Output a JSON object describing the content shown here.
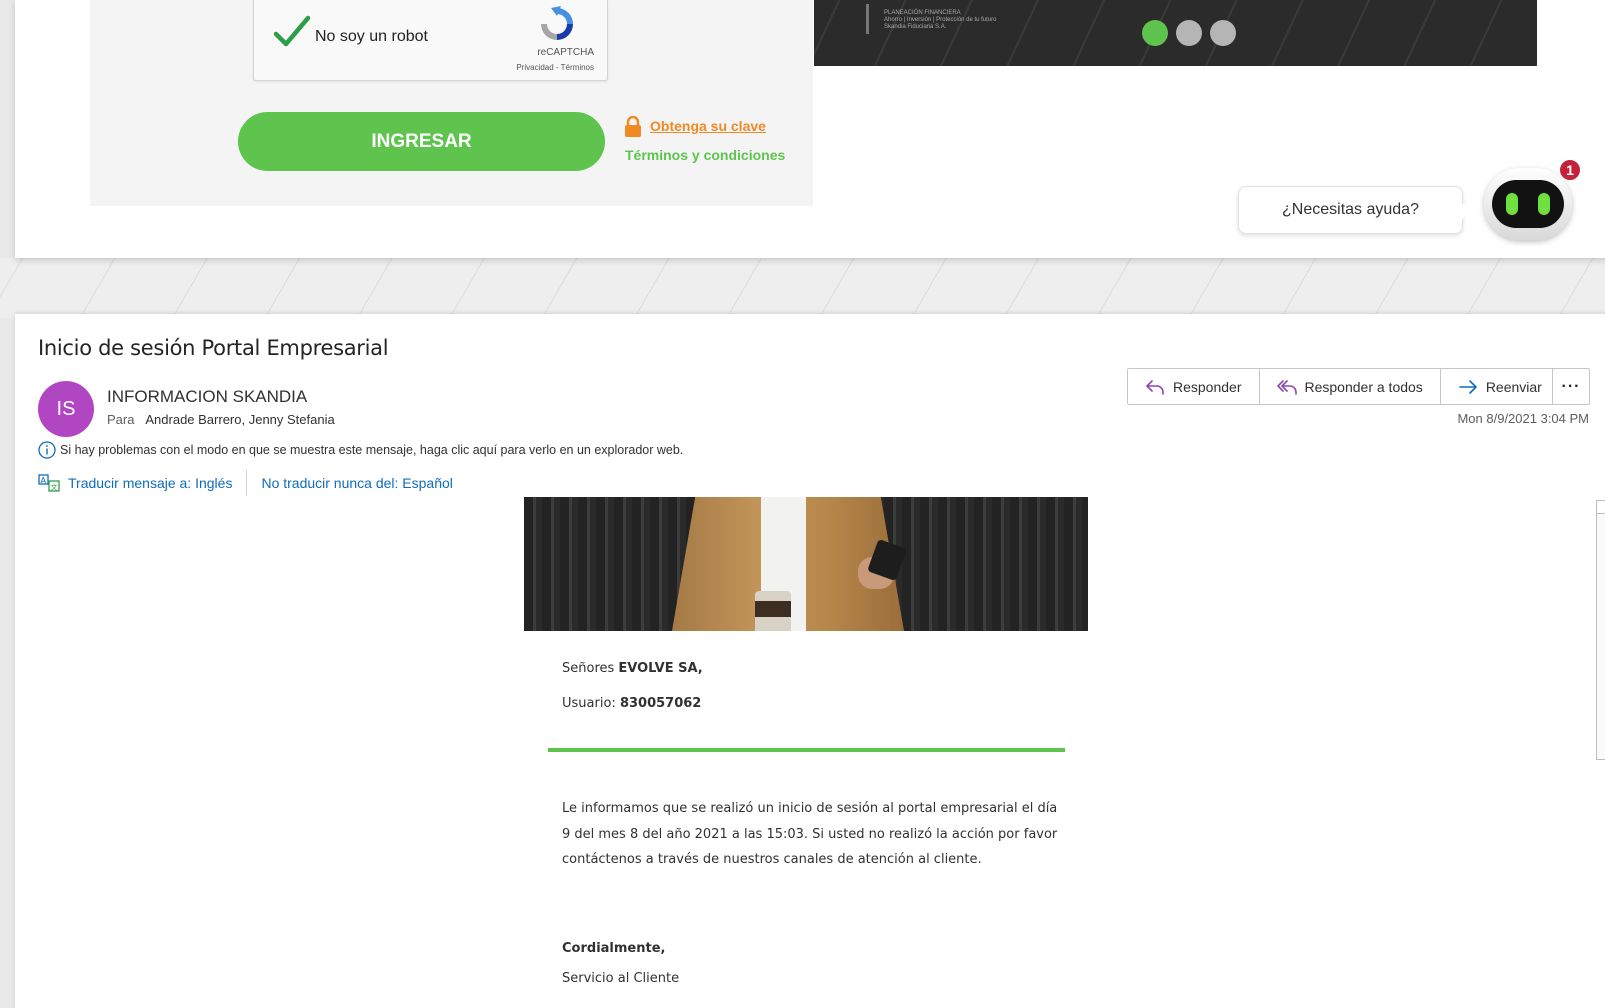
{
  "login": {
    "captcha_label": "No soy un robot",
    "captcha_brand": "reCAPTCHA",
    "captcha_links": "Privacidad - Términos",
    "submit_label": "INGRESAR",
    "get_key_link": "Obtenga su clave",
    "terms_link": "Términos y condiciones",
    "banner_text": "PLANEACIÓN FINANCIERA\nAhorro | Inversión | Protección de tu futuro\nSkandia Fiduciaria S.A.",
    "carousel": {
      "count": 3,
      "active_index": 0
    },
    "help_text": "¿Necesitas ayuda?",
    "help_badge": "1",
    "accent_color": "#5ec44e",
    "link_color": "#f08a24"
  },
  "email": {
    "subject": "Inicio de sesión Portal Empresarial",
    "avatar_initials": "IS",
    "avatar_color": "#b146c2",
    "sender": "INFORMACION SKANDIA",
    "to_label": "Para",
    "to": "Andrade Barrero, Jenny Stefania",
    "actions": {
      "reply": "Responder",
      "reply_all": "Responder a todos",
      "forward": "Reenviar",
      "more": "···"
    },
    "date": "Mon 8/9/2021 3:04 PM",
    "info_notice": "Si hay problemas con el modo en que se muestra este mensaje, haga clic aquí para verlo en un explorador web.",
    "translate_link": "Traducir mensaje a: Inglés",
    "never_translate_link": "No traducir nunca del: Español",
    "body": {
      "greeting_prefix": "Señores",
      "greeting_name": "EVOLVE SA,",
      "user_label": "Usuario:",
      "user_value": "830057062",
      "paragraph": "Le informamos que se realizó un inicio de sesión al portal empresarial el día 9 del mes 8 del año 2021 a las 15:03. Si usted no realizó la acción por favor contáctenos a través de nuestros canales de atención al cliente.",
      "closing": "Cordialmente,",
      "signature": "Servicio al Cliente"
    }
  }
}
